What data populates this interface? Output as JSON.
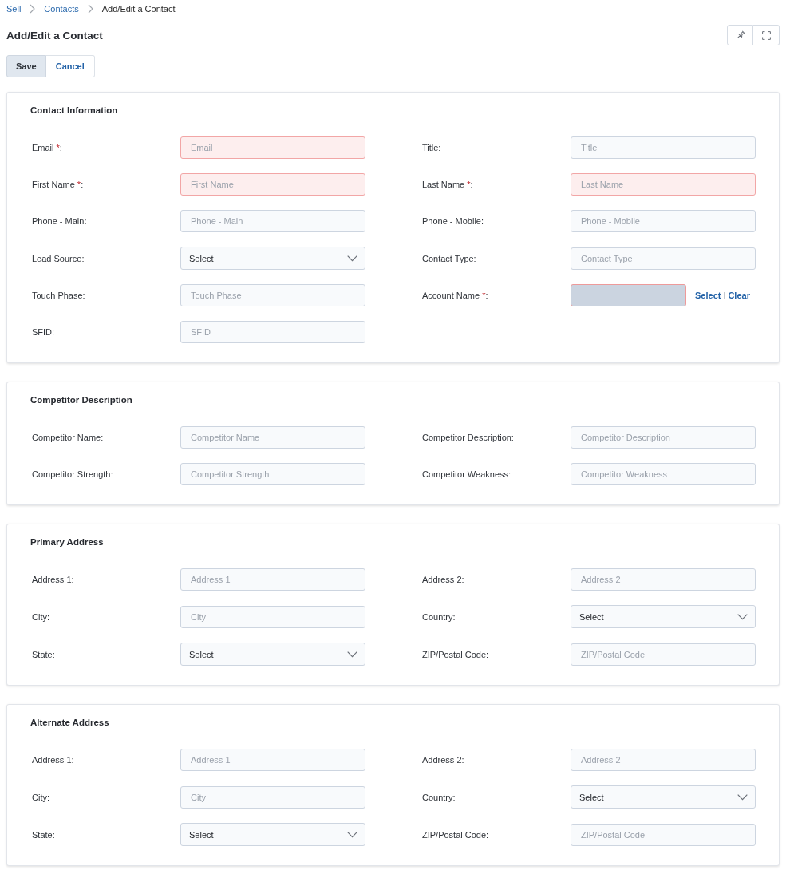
{
  "breadcrumb": [
    {
      "label": "Sell",
      "current": false
    },
    {
      "label": "Contacts",
      "current": false
    },
    {
      "label": "Add/Edit a Contact",
      "current": true
    }
  ],
  "page_title": "Add/Edit a Contact",
  "actions": [
    {
      "label": "Save",
      "kind": "default"
    },
    {
      "label": "Cancel",
      "kind": "link"
    }
  ],
  "sections": [
    {
      "title": "Contact Information",
      "fields": [
        {
          "label": "Email",
          "required_mark": "*",
          "label_end": ":",
          "kind": "input",
          "placeholder": "Email",
          "invalid": true
        },
        {
          "label": "Title:",
          "kind": "input",
          "placeholder": "Title",
          "invalid": false
        },
        {
          "label": "First Name",
          "required_mark": "*",
          "label_end": ":",
          "kind": "input",
          "placeholder": "First Name",
          "invalid": true
        },
        {
          "label": "Last Name",
          "required_mark": "*",
          "label_end": ":",
          "kind": "input",
          "placeholder": "Last Name",
          "invalid": true
        },
        {
          "label": "Phone - Main:",
          "kind": "input",
          "placeholder": "Phone - Main",
          "invalid": false
        },
        {
          "label": "Phone - Mobile:",
          "kind": "input",
          "placeholder": "Phone - Mobile",
          "invalid": false
        },
        {
          "label": "Lead Source:",
          "kind": "select",
          "value": "Select",
          "invalid": false
        },
        {
          "label": "Contact Type:",
          "kind": "input",
          "placeholder": "Contact Type",
          "invalid": false
        },
        {
          "label": "Touch Phase:",
          "kind": "input",
          "placeholder": "Touch Phase",
          "invalid": false
        },
        {
          "label": "Account Name",
          "required_mark": "*",
          "label_end": ":",
          "kind": "lookup",
          "actions": [
            "Select",
            "Clear"
          ],
          "invalid": true
        },
        {
          "label": "SFID:",
          "kind": "input",
          "placeholder": "SFID",
          "invalid": false
        }
      ]
    },
    {
      "title": "Competitor Description",
      "fields": [
        {
          "label": "Competitor Name:",
          "kind": "input",
          "placeholder": "Competitor Name",
          "invalid": false
        },
        {
          "label": "Competitor Description:",
          "kind": "input",
          "placeholder": "Competitor Description",
          "invalid": false
        },
        {
          "label": "Competitor Strength:",
          "kind": "input",
          "placeholder": "Competitor Strength",
          "invalid": false
        },
        {
          "label": "Competitor Weakness:",
          "kind": "input",
          "placeholder": "Competitor Weakness",
          "invalid": false
        }
      ]
    },
    {
      "title": "Primary Address",
      "fields": [
        {
          "label": "Address 1:",
          "kind": "input",
          "placeholder": "Address 1",
          "invalid": false
        },
        {
          "label": "Address 2:",
          "kind": "input",
          "placeholder": "Address 2",
          "invalid": false
        },
        {
          "label": "City:",
          "kind": "input",
          "placeholder": "City",
          "invalid": false
        },
        {
          "label": "Country:",
          "kind": "select",
          "value": "Select",
          "invalid": false
        },
        {
          "label": "State:",
          "kind": "select",
          "value": "Select",
          "invalid": false
        },
        {
          "label": "ZIP/Postal Code:",
          "kind": "input",
          "placeholder": "ZIP/Postal Code",
          "invalid": false
        }
      ]
    },
    {
      "title": "Alternate Address",
      "fields": [
        {
          "label": "Address 1:",
          "kind": "input",
          "placeholder": "Address 1",
          "invalid": false
        },
        {
          "label": "Address 2:",
          "kind": "input",
          "placeholder": "Address 2",
          "invalid": false
        },
        {
          "label": "City:",
          "kind": "input",
          "placeholder": "City",
          "invalid": false
        },
        {
          "label": "Country:",
          "kind": "select",
          "value": "Select",
          "invalid": false
        },
        {
          "label": "State:",
          "kind": "select",
          "value": "Select",
          "invalid": false
        },
        {
          "label": "ZIP/Postal Code:",
          "kind": "input",
          "placeholder": "ZIP/Postal Code",
          "invalid": false
        }
      ]
    }
  ]
}
